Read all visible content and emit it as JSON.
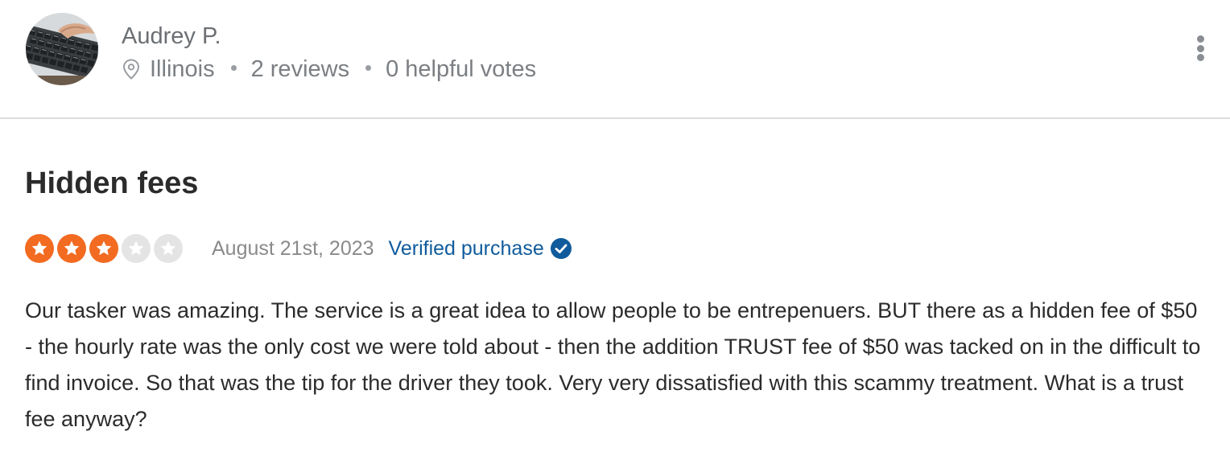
{
  "reviewer": {
    "name": "Audrey P.",
    "location": "Illinois",
    "reviews_count": "2 reviews",
    "helpful_votes": "0 helpful votes",
    "location_icon": "map-pin-icon",
    "more_icon": "more-vertical-icon"
  },
  "review": {
    "title": "Hidden fees",
    "rating": 3,
    "max_rating": 5,
    "date": "August 21st, 2023",
    "verified_label": "Verified purchase",
    "verified_icon": "check-circle-icon",
    "body": "Our tasker was amazing. The service is a great idea to allow people to be entrepenuers. BUT there as a hidden fee of $50 - the hourly rate was the only cost we were told about - then the addition TRUST fee of $50 was tacked on in the difficult to find invoice. So that was the tip for the driver they took. Very very dissatisfied with this scammy treatment. What is a trust fee anyway?"
  },
  "colors": {
    "star_filled": "#f26b21",
    "star_empty": "#e4e4e4",
    "verified": "#0f5b9c",
    "text": "#2b2b2b",
    "muted": "#7b7f83"
  }
}
